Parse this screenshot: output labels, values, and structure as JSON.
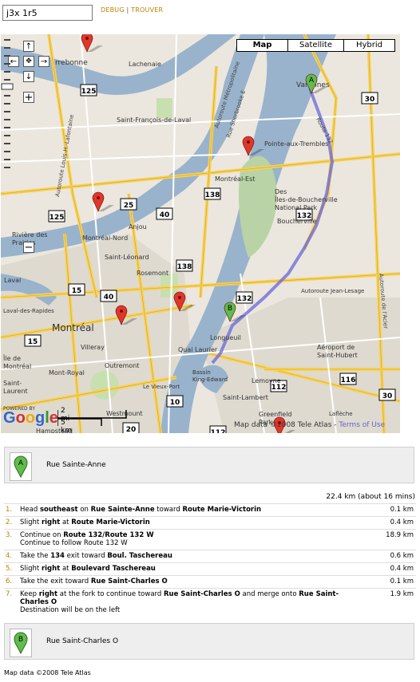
{
  "search": {
    "value": "j3x 1r5"
  },
  "links": {
    "debug": "DEBUG",
    "separator": "|",
    "find": "TROUVER"
  },
  "map": {
    "types": [
      "Map",
      "Satellite",
      "Hybrid"
    ],
    "selected_type": "Map",
    "scale_mi": "2 mi",
    "scale_km": "5 km",
    "copyright": "Map data ©2008 Tele Atlas -",
    "terms": "Terms of Use",
    "powered_by": "POWERED BY",
    "google": "Google",
    "place_labels": {
      "terrebonne": "rrebonne",
      "lachenaie": "Lachenaie",
      "varennes": "Varennes",
      "saint_francois": "Saint-François-de-Laval",
      "pointe_aux_trembles": "Pointe-aux-Trembles",
      "montreal_est": "Montréal-Est",
      "iles_boucherville": "Des\nÎles-de-Boucherville\nNational Park",
      "boucherville": "Boucherville",
      "anjou": "Anjou",
      "montreal_nord": "Montréal-Nord",
      "riviere_prairies": "Rivière des\nPrairies",
      "saint_leonard": "Saint-Léonard",
      "rosemont": "Rosemont",
      "laval": "Laval",
      "laval_rapides": "Laval-des-Rapides",
      "montreal": "Montréal",
      "villeray": "Villeray",
      "outremont": "Outremont",
      "mont_royal": "Mont-Royal",
      "vieux_port": "Le Vieux-Port",
      "quai_laurier": "Quai Laurier",
      "longueuil": "Longueuil",
      "bassin": "Bassin\nKing-Edward",
      "saint_lambert": "Saint-Lambert",
      "lemoyne": "Lemoyne",
      "aeroport": "Aéroport de\nSaint-Hubert",
      "greenfield": "Greenfield\nPark",
      "laflèche": "Laflèche",
      "westmount": "Westmount",
      "hampstead": "Hampstead",
      "ile_dorval": "Île de\nMontréal",
      "saint_laurent": "Saint-\nLaurent",
      "autoroute_jean_lesage": "Autoroute Jean-Lesage",
      "autoroute_metropolitaine": "Autoroute Métropolitaine",
      "rue_sherbrooke": "Rue Sherbrooke E",
      "autoroute_lafontaine": "Autoroute Louis-H.-Lafontaine",
      "autoroute_acier": "Autoroute de l'Acier",
      "route_132": "Route 132"
    },
    "shields": [
      "125",
      "30",
      "138",
      "25",
      "40",
      "125",
      "132",
      "138",
      "40",
      "15",
      "132",
      "15",
      "10",
      "112",
      "116",
      "30",
      "20",
      "112"
    ]
  },
  "directions": {
    "start": {
      "marker": "A",
      "label": "Rue Sainte-Anne"
    },
    "summary": "22.4 km (about 16 mins)",
    "steps": [
      {
        "num": "1.",
        "text_parts": [
          "Head ",
          "southeast",
          " on ",
          "Rue Sainte-Anne",
          " toward ",
          "Route Marie-Victorin"
        ],
        "bold": [
          1,
          3,
          5
        ],
        "sub": "",
        "dist": "0.1 km"
      },
      {
        "num": "2.",
        "text_parts": [
          "Slight ",
          "right",
          " at ",
          "Route Marie-Victorin"
        ],
        "bold": [
          1,
          3
        ],
        "sub": "",
        "dist": "0.4 km"
      },
      {
        "num": "3.",
        "text_parts": [
          "Continue on ",
          "Route 132/Route 132 W"
        ],
        "bold": [
          1
        ],
        "sub": "Continue to follow Route 132 W",
        "dist": "18.9 km"
      },
      {
        "num": "4.",
        "text_parts": [
          "Take the ",
          "134",
          " exit toward ",
          "Boul. Taschereau"
        ],
        "bold": [
          1,
          3
        ],
        "sub": "",
        "dist": "0.6 km"
      },
      {
        "num": "5.",
        "text_parts": [
          "Slight ",
          "right",
          " at ",
          "Boulevard Taschereau"
        ],
        "bold": [
          1,
          3
        ],
        "sub": "",
        "dist": "0.4 km"
      },
      {
        "num": "6.",
        "text_parts": [
          "Take the exit toward ",
          "Rue Saint-Charles O"
        ],
        "bold": [
          1
        ],
        "sub": "",
        "dist": "0.1 km"
      },
      {
        "num": "7.",
        "text_parts": [
          "Keep ",
          "right",
          " at the fork to continue toward ",
          "Rue Saint-Charles O",
          " and merge onto ",
          "Rue Saint-Charles O"
        ],
        "bold": [
          1,
          3,
          5
        ],
        "sub": "Destination will be on the left",
        "dist": "1.9 km"
      }
    ],
    "end": {
      "marker": "B",
      "label": "Rue Saint-Charles O"
    }
  },
  "footer": "Map data ©2008 Tele Atlas",
  "colors": {
    "water": "#99b3cc",
    "land": "#ebe7de",
    "park": "#c8dfb0",
    "urban": "#dedad0",
    "road": "#ffffff",
    "highway": "#f7d15b",
    "route": "#6a65d9",
    "marker_red": "#e0372b",
    "marker_green": "#5fbd4b",
    "link": "#c08000"
  }
}
